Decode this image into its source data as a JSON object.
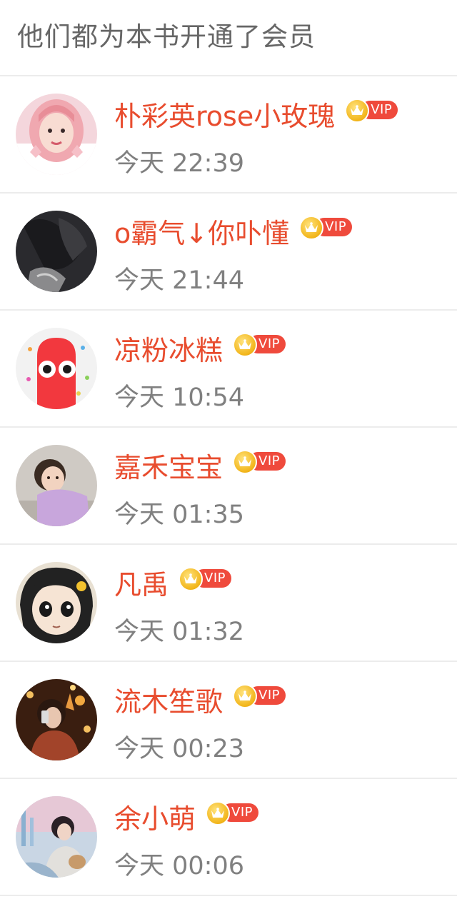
{
  "header": {
    "title": "他们都为本书开通了会员"
  },
  "vip_label": "VIP",
  "colors": {
    "name": "#e84c2e",
    "vip_badge": "#ef4a3c",
    "time": "#808080",
    "header": "#666666"
  },
  "members": [
    {
      "name": "朴彩英rose小玫瑰",
      "time": "今天 22:39",
      "avatar": "pink-hair-girl-avatar"
    },
    {
      "name": "o霸气↓你卟懂",
      "time": "今天 21:44",
      "avatar": "dark-figure-avatar"
    },
    {
      "name": "凉粉冰糕",
      "time": "今天 10:54",
      "avatar": "red-cartoon-avatar"
    },
    {
      "name": "嘉禾宝宝",
      "time": "今天 01:35",
      "avatar": "toddler-avatar"
    },
    {
      "name": "凡禹",
      "time": "今天 01:32",
      "avatar": "anime-girl-avatar"
    },
    {
      "name": "流木笙歌",
      "time": "今天 00:23",
      "avatar": "phone-girl-avatar"
    },
    {
      "name": "余小萌",
      "time": "今天 00:06",
      "avatar": "dreamy-girl-avatar"
    }
  ]
}
